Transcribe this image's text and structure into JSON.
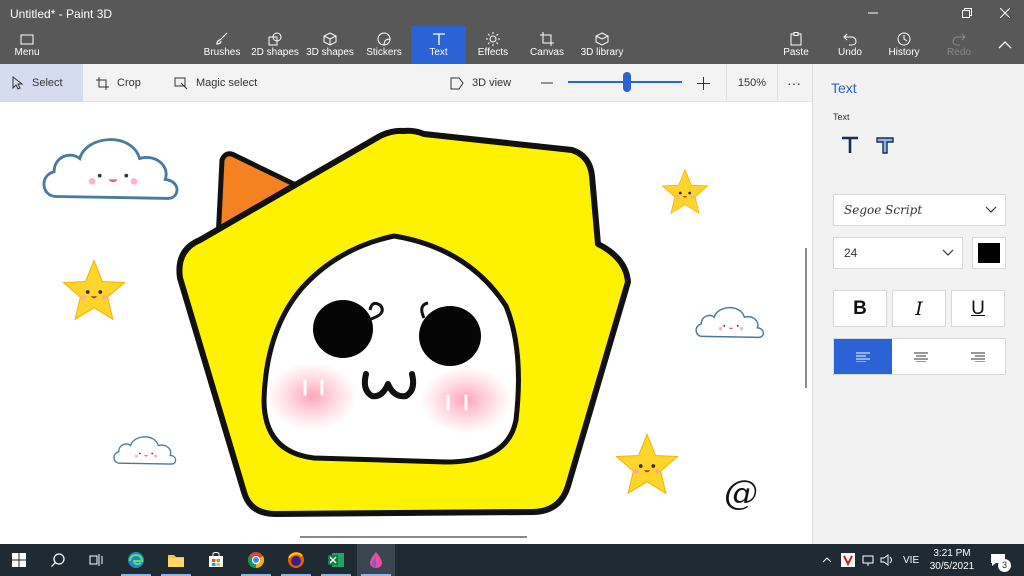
{
  "window": {
    "title": "Untitled* - Paint 3D"
  },
  "toolbar": {
    "menu": "Menu",
    "tools": [
      "Brushes",
      "2D shapes",
      "3D shapes",
      "Stickers",
      "Text",
      "Effects",
      "Canvas",
      "3D library"
    ],
    "active_tool": "Text",
    "right": [
      "Paste",
      "Undo",
      "History",
      "Redo"
    ]
  },
  "subbar": {
    "select": "Select",
    "crop": "Crop",
    "magic_select": "Magic select",
    "view_3d": "3D view",
    "zoom": "150%",
    "zoom_level": 0.5,
    "more": "···"
  },
  "canvas": {
    "at_text": "@"
  },
  "panel": {
    "title": "Text",
    "subheading": "Text",
    "font": "Segoe Script",
    "size": "24",
    "color": "#000000",
    "bold": "B",
    "italic": "I",
    "underline": "U",
    "alignment": "left"
  },
  "taskbar": {
    "apps": [
      "windows-icon",
      "search-icon",
      "task-view-icon",
      "edge-icon",
      "file-explorer-icon",
      "store-icon",
      "chrome-icon",
      "firefox-icon",
      "excel-icon",
      "paint3d-icon"
    ],
    "language": "VIE",
    "time": "3:21 PM",
    "date": "30/5/2021",
    "notification_count": "3"
  },
  "colors": {
    "accent": "#2b62d6",
    "titlebar": "#585858",
    "taskbar": "#1f2a33",
    "yellow": "#ffee00",
    "orange": "#f58220"
  }
}
